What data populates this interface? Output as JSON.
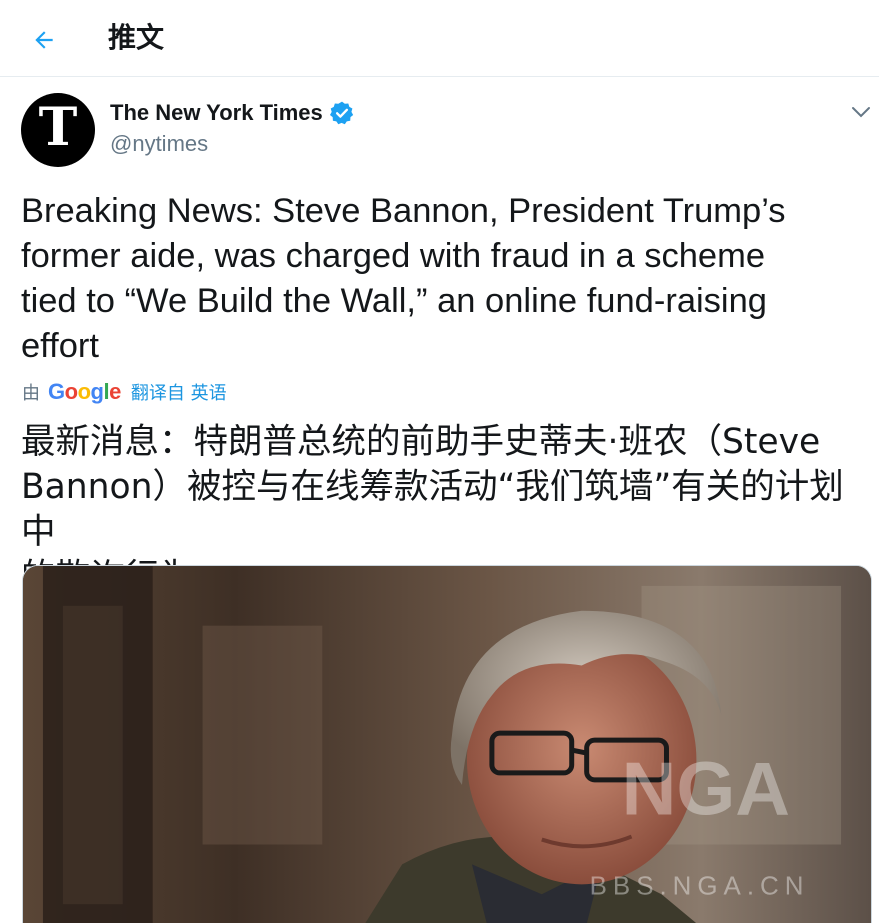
{
  "header": {
    "title": "推文",
    "back_icon": "arrow-left-icon"
  },
  "tweet": {
    "author_name": "The New York Times",
    "author_handle": "@nytimes",
    "avatar_letter": "T",
    "verified": true,
    "text_lines": [
      "Breaking News: Steve Bannon, President Trump’s",
      "former aide, was charged with fraud in a scheme",
      "tied to “We Build the Wall,” an online fund-raising",
      "effort"
    ],
    "translation": {
      "by_label": "由",
      "provider": "Google",
      "link_label": "翻译自 英语",
      "text_lines": [
        "最新消息：特朗普总统的前助手史蒂夫·班农（Steve",
        "Bannon）被控与在线筹款活动“我们筑墙”有关的计划中",
        "的欺诈行为"
      ]
    },
    "media": {
      "watermark_large": "NGA",
      "watermark_small": "BBS.NGA.CN"
    }
  },
  "colors": {
    "accent": "#1b95e0",
    "verified": "#1da1f2",
    "secondary_text": "#657786",
    "divider": "#e6ecf0"
  }
}
